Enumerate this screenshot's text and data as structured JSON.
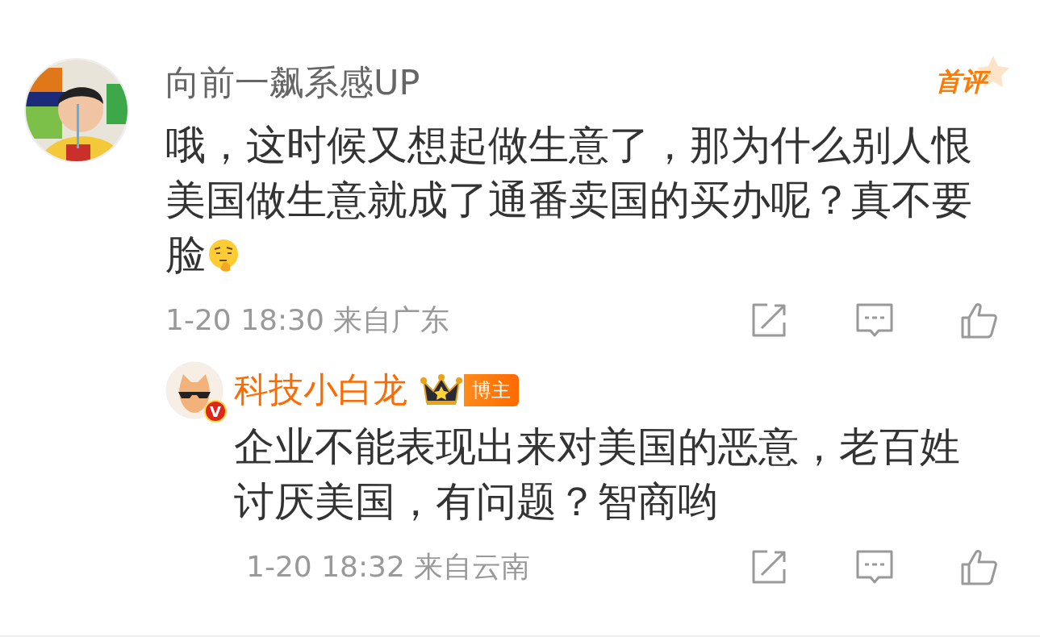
{
  "comment": {
    "author": "向前一飙系感UP",
    "badge": "首评",
    "text_lines": [
      "哦，这时候又想起做生意了，那为什么别人恨",
      "美国做生意就成了通番卖国的买办呢？真不要",
      "脸"
    ],
    "time": "1-20 18:30 来自广东",
    "reply": {
      "author": "科技小白龙",
      "verified": true,
      "verified_label": "V",
      "role_tag": "博主",
      "text": "企业不能表现出来对美国的恶意，老百姓讨厌美国，有问题？智商哟",
      "time": "1-20 18:32 来自云南"
    }
  }
}
